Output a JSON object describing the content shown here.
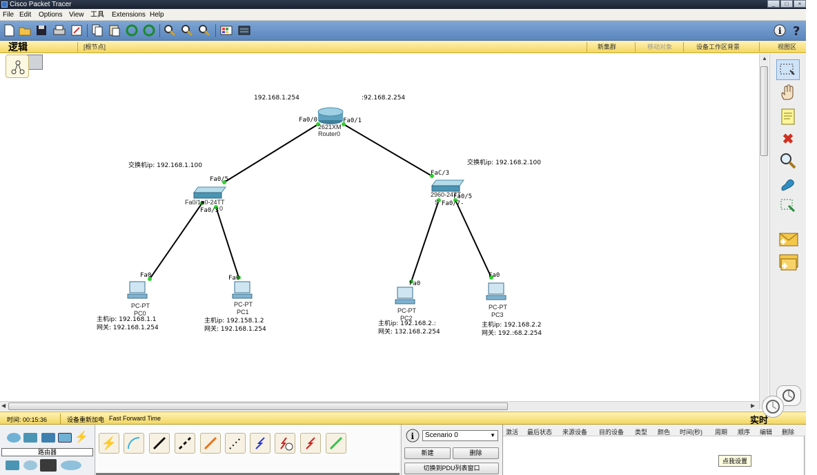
{
  "window": {
    "title": "Cisco Packet Tracer",
    "buttons": [
      "_",
      "□",
      "×"
    ]
  },
  "menu": {
    "items": [
      "File",
      "Edit",
      "Options",
      "View",
      "工具",
      "Extensions",
      "Help"
    ]
  },
  "logic_bar": {
    "label": "逻辑",
    "root": "[根节点]",
    "new_cluster": "新集群",
    "move_object": "移动对象",
    "set_background": "设备工作区背景",
    "viewport": "视图区"
  },
  "network": {
    "router": {
      "model": "2621XM",
      "name": "Router0",
      "ip_left": "192.168.1.254",
      "ip_right": ":92.168.2.254",
      "port_left": "Fa0/0",
      "port_right": "Fa0/1"
    },
    "switch0": {
      "label": "Fa0/1■0-24TT",
      "name_tail": "0",
      "ip": "交换机ip: 192.168.1.100",
      "port_up": "Fa0/5",
      "port_down_left": "Fa0/1",
      "port_down_right": "Fa0/3"
    },
    "switch1": {
      "label": "2960-24TT",
      "name_tail": "S",
      "ip": "交换机ip: 192.168.2.100",
      "port_up": "FaC/3",
      "port_down_left": "Fa0/7-",
      "port_down_right": "Fa0/5"
    },
    "pcs": [
      {
        "type": "PC-PT",
        "name": "PC0",
        "port": "Fa0",
        "host": "主机ip: 192.168.1.1",
        "gateway": "网关: 192.168.1.254"
      },
      {
        "type": "PC-PT",
        "name": "PC1",
        "port": "Fa0",
        "host": "主机ip: 192.158.1.2",
        "gateway": "网关: 192.168.1.254"
      },
      {
        "type": "PC-PT",
        "name": "PC2",
        "port": "Fa0",
        "host": "主机ip: 192.168.2.:",
        "gateway": "网关: 132.168.2.254"
      },
      {
        "type": "PC-PT",
        "name": "PC3",
        "port": "Fa0",
        "host": "主机ip: 192.168.2.2",
        "gateway": "网关: 192.:68.2.254"
      }
    ]
  },
  "status": {
    "time": "时间: 00:15:36",
    "power_cycle": "设备重新加电",
    "fast_forward": "Fast Forward Time",
    "realtime": "实时"
  },
  "bottom": {
    "category_label": "路由器",
    "scenario": "Scenario 0",
    "new_btn": "新建",
    "delete_btn": "删除",
    "switch_pdu": "切换到PDU列表窗口",
    "pdu_columns": [
      "激活",
      "最后状态",
      "来源设备",
      "目的设备",
      "类型",
      "颜色",
      "时间(秒)",
      "周期",
      "顺序",
      "编辑",
      "删除"
    ],
    "tooltip": "点我设置"
  },
  "colors": {
    "toolbar": "#6b95c9",
    "logic_bar": "#f7e38c",
    "link": "#000000",
    "port_up": "#2fd12f"
  }
}
